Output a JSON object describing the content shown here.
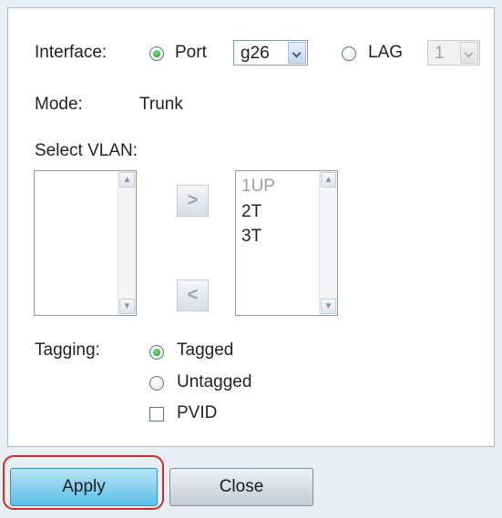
{
  "interface": {
    "label": "Interface:",
    "port_label": "Port",
    "port_value": "g26",
    "lag_label": "LAG",
    "lag_value": "1",
    "selected": "port"
  },
  "mode": {
    "label": "Mode:",
    "value": "Trunk"
  },
  "select_vlan": {
    "label": "Select VLAN:"
  },
  "available_list": {
    "items": []
  },
  "selected_list": {
    "items": [
      "1UP",
      "2T",
      "3T"
    ]
  },
  "move_buttons": {
    "add": ">",
    "remove": "<"
  },
  "tagging": {
    "label": "Tagging:",
    "tagged_label": "Tagged",
    "untagged_label": "Untagged",
    "pvid_label": "PVID",
    "selected": "tagged",
    "pvid_checked": false
  },
  "buttons": {
    "apply": "Apply",
    "close": "Close"
  },
  "colors": {
    "highlight": "#cc2c2c",
    "apply": "#5cbfe8",
    "radio_selected": "#1f9a24"
  }
}
